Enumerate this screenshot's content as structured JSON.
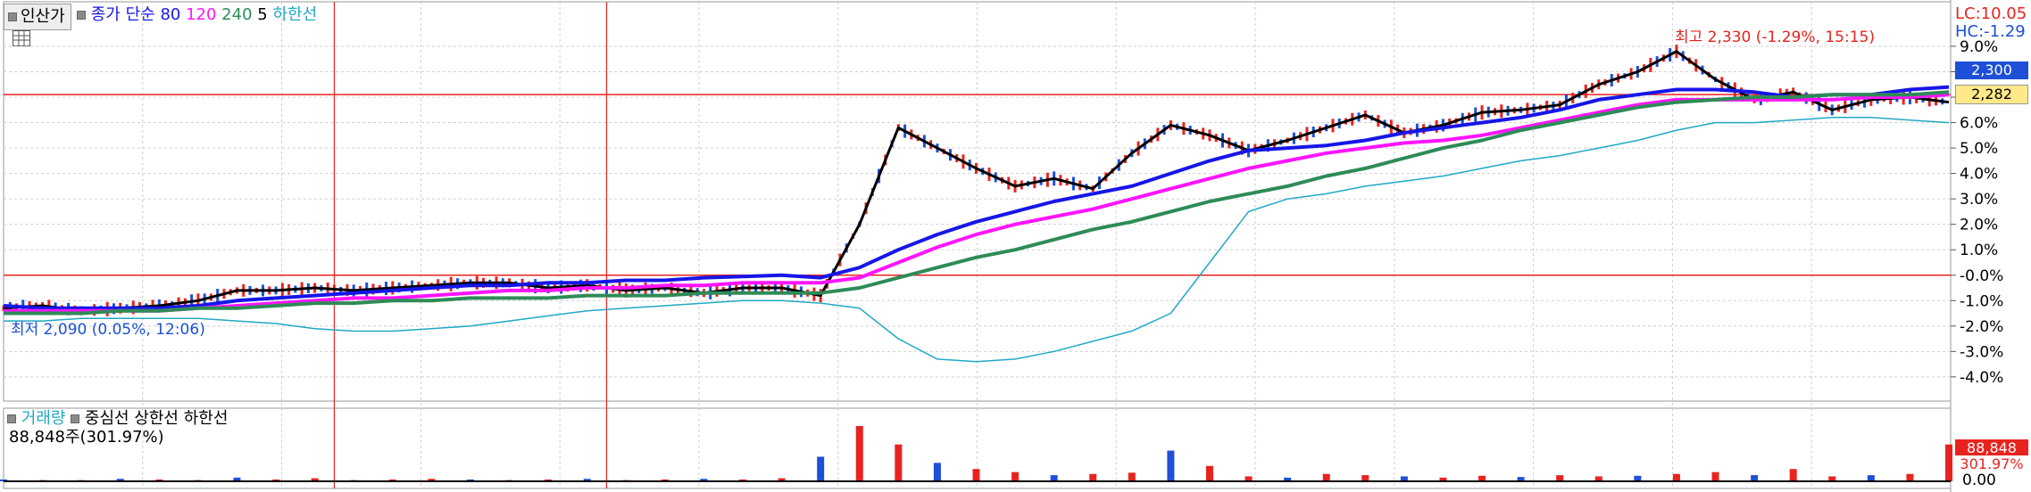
{
  "colors": {
    "up": "#e8231f",
    "down": "#1d4fd8",
    "price": "#000000",
    "ma80": "#1616e8",
    "ma120": "#ff14ff",
    "ma240": "#2e8b57",
    "ma5": "#000000",
    "lower_band": "#22a8c4",
    "grid": "#cfcfcf",
    "ref_line": "#e8231f"
  },
  "header": {
    "tab_label": "인산가",
    "legend_prefix": "종가 단순",
    "ma80": "80",
    "ma120": "120",
    "ma240": "240",
    "ma5": "5",
    "lower_band": "하한선",
    "grid_icon": "grid-icon"
  },
  "price_panel": {
    "annotation_high": "최고 2,330 (-1.29%, 15:15)",
    "annotation_low": "최저 2,090 (0.05%, 12:06)",
    "lc_label": "LC:10.05",
    "hc_label": "HC:-1.29",
    "price_tag_blue": "2,300",
    "price_tag_yellow": "2,282"
  },
  "volume_panel": {
    "legend_volume": "거래량",
    "legend_center": "중심선",
    "legend_upper": "상한선",
    "legend_lower": "하한선",
    "volume_text": "88,848주(301.97%)",
    "tag_value": "88,848",
    "tag_pct": "301.97%",
    "axis_zero": "0.00"
  },
  "chart_data": {
    "type": "line",
    "y_axis_unit": "percent change",
    "ylim": [
      -4.6,
      10.05
    ],
    "yticks": [
      "9.0%",
      "8.0%",
      "7.0%",
      "6.0%",
      "5.0%",
      "4.0%",
      "3.0%",
      "2.0%",
      "1.0%",
      "-0.0%",
      "-1.0%",
      "-2.0%",
      "-3.0%",
      "-4.0%"
    ],
    "ytick_values": [
      9,
      8,
      7,
      6,
      5,
      4,
      3,
      2,
      1,
      0,
      -1,
      -2,
      -3,
      -4
    ],
    "x": [
      0,
      2,
      4,
      6,
      8,
      10,
      12,
      14,
      16,
      18,
      20,
      22,
      24,
      26,
      28,
      30,
      32,
      34,
      36,
      38,
      40,
      42,
      44,
      46,
      48,
      50,
      52,
      54,
      56,
      58,
      60,
      62,
      64,
      66,
      68,
      70,
      72,
      74,
      76,
      78,
      80,
      82,
      84,
      86,
      88,
      90,
      92,
      94,
      96,
      98,
      100
    ],
    "series": [
      {
        "name": "종가",
        "values": [
          -1.3,
          -1.2,
          -1.4,
          -1.3,
          -1.2,
          -1.0,
          -0.6,
          -0.6,
          -0.5,
          -0.6,
          -0.5,
          -0.4,
          -0.3,
          -0.3,
          -0.5,
          -0.4,
          -0.6,
          -0.5,
          -0.7,
          -0.5,
          -0.5,
          -0.8,
          2.0,
          5.8,
          5.0,
          4.2,
          3.5,
          3.8,
          3.4,
          4.8,
          5.9,
          5.5,
          4.9,
          5.3,
          5.8,
          6.3,
          5.6,
          5.9,
          6.4,
          6.5,
          6.7,
          7.5,
          8.0,
          8.8,
          7.7,
          6.9,
          7.2,
          6.5,
          6.9,
          7.0,
          6.8
        ]
      },
      {
        "name": "80",
        "values": [
          -1.2,
          -1.3,
          -1.3,
          -1.3,
          -1.3,
          -1.2,
          -1.0,
          -0.9,
          -0.8,
          -0.7,
          -0.6,
          -0.5,
          -0.4,
          -0.4,
          -0.3,
          -0.3,
          -0.2,
          -0.2,
          -0.1,
          -0.05,
          0.0,
          -0.1,
          0.3,
          1.0,
          1.6,
          2.1,
          2.5,
          2.9,
          3.2,
          3.5,
          4.0,
          4.5,
          4.9,
          5.0,
          5.1,
          5.3,
          5.6,
          5.8,
          6.0,
          6.2,
          6.5,
          6.9,
          7.1,
          7.3,
          7.3,
          7.2,
          7.0,
          7.1,
          7.1,
          7.3,
          7.4
        ]
      },
      {
        "name": "120",
        "values": [
          -1.4,
          -1.4,
          -1.4,
          -1.4,
          -1.4,
          -1.3,
          -1.2,
          -1.1,
          -1.0,
          -0.9,
          -0.9,
          -0.8,
          -0.7,
          -0.6,
          -0.6,
          -0.5,
          -0.5,
          -0.4,
          -0.4,
          -0.3,
          -0.3,
          -0.3,
          -0.1,
          0.5,
          1.1,
          1.6,
          2.0,
          2.3,
          2.6,
          3.0,
          3.4,
          3.8,
          4.2,
          4.5,
          4.8,
          5.0,
          5.2,
          5.3,
          5.5,
          5.8,
          6.1,
          6.4,
          6.7,
          6.9,
          6.9,
          6.9,
          6.9,
          6.9,
          7.0,
          7.0,
          7.1
        ]
      },
      {
        "name": "240",
        "values": [
          -1.5,
          -1.5,
          -1.5,
          -1.4,
          -1.4,
          -1.3,
          -1.3,
          -1.2,
          -1.1,
          -1.1,
          -1.0,
          -1.0,
          -0.9,
          -0.9,
          -0.9,
          -0.8,
          -0.8,
          -0.8,
          -0.7,
          -0.7,
          -0.7,
          -0.7,
          -0.5,
          -0.1,
          0.3,
          0.7,
          1.0,
          1.4,
          1.8,
          2.1,
          2.5,
          2.9,
          3.2,
          3.5,
          3.9,
          4.2,
          4.6,
          5.0,
          5.3,
          5.7,
          6.0,
          6.3,
          6.6,
          6.8,
          6.9,
          7.0,
          7.0,
          7.1,
          7.1,
          7.1,
          7.2
        ]
      },
      {
        "name": "하한선",
        "values": [
          -1.8,
          -1.8,
          -1.7,
          -1.7,
          -1.7,
          -1.7,
          -1.8,
          -1.9,
          -2.1,
          -2.2,
          -2.2,
          -2.1,
          -2.0,
          -1.8,
          -1.6,
          -1.4,
          -1.3,
          -1.2,
          -1.1,
          -1.0,
          -1.0,
          -1.1,
          -1.3,
          -2.5,
          -3.3,
          -3.4,
          -3.3,
          -3.0,
          -2.6,
          -2.2,
          -1.5,
          0.5,
          2.5,
          3.0,
          3.2,
          3.5,
          3.7,
          3.9,
          4.2,
          4.5,
          4.7,
          5.0,
          5.3,
          5.7,
          6.0,
          6.0,
          6.1,
          6.2,
          6.2,
          6.1,
          6.0
        ]
      }
    ],
    "volume": [
      3,
      2,
      2,
      4,
      3,
      2,
      6,
      3,
      5,
      2,
      3,
      4,
      3,
      2,
      3,
      4,
      2,
      3,
      4,
      3,
      5,
      40,
      90,
      60,
      30,
      20,
      15,
      10,
      12,
      14,
      50,
      25,
      8,
      6,
      12,
      10,
      8,
      6,
      9,
      7,
      10,
      8,
      9,
      12,
      15,
      10,
      20,
      8,
      10,
      12,
      60
    ]
  }
}
